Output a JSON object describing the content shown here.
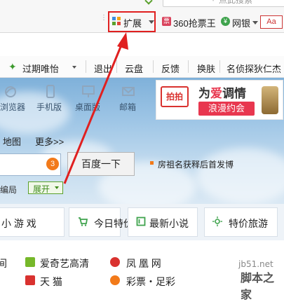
{
  "browser_toolbar": {
    "address_placeholder": "点此搜索",
    "extension_label": "扩展",
    "items": [
      {
        "label": "360抢票王"
      },
      {
        "label": "网银"
      },
      {
        "label": "Aa"
      }
    ]
  },
  "favorites_bar": {
    "items": [
      "过期唯怡",
      "退出",
      "云盘",
      "反馈",
      "换肤",
      "名侦探狄仁杰"
    ]
  },
  "quick_icons": [
    "浏览器",
    "手机版",
    "桌面版",
    "邮箱"
  ],
  "ad": {
    "logo": "拍拍",
    "line1_prefix": "为",
    "line1_love": "爱",
    "line1_suffix": "调情",
    "line2": "浪漫约会"
  },
  "search": {
    "nav_links": [
      "地图",
      "更多>>"
    ],
    "suggest_count": "3",
    "button_label": "百度一下",
    "hot_text": "房祖名获释后首发博",
    "edit_label": "编局",
    "expand_label": "展开"
  },
  "categories": [
    {
      "label": "小 游 戏"
    },
    {
      "label": "今日特价"
    },
    {
      "label": "最新小说"
    },
    {
      "label": "特价旅游"
    }
  ],
  "sites": [
    {
      "label": "间"
    },
    {
      "label": "爱奇艺高清"
    },
    {
      "label": "凤 凰 网"
    },
    {
      "label": "天   猫"
    },
    {
      "label": "彩票・足彩"
    }
  ],
  "watermark": {
    "url": "jb51.net",
    "text": "脚本之家"
  },
  "colors": {
    "highlight_red": "#e02020",
    "accent_green": "#5aa02c",
    "ad_pink": "#e8374f",
    "badge_orange": "#f27a1a"
  }
}
